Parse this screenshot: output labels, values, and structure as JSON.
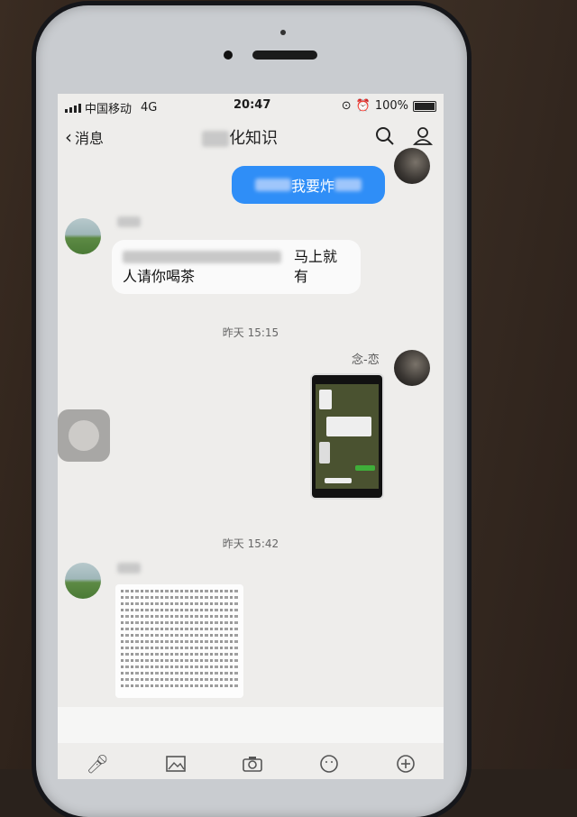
{
  "status": {
    "carrier": "中国移动",
    "network": "4G",
    "time": "20:47",
    "battery": "100%"
  },
  "nav": {
    "back_label": "消息",
    "title_visible": "化知识"
  },
  "messages": {
    "m1_text": "我要炸",
    "m2_text_line1": "马上就有",
    "m2_text_line2": "人请你喝茶",
    "ts1": "昨天 15:15",
    "m3_nick": "念-恋",
    "ts2": "昨天 15:42"
  },
  "colors": {
    "bubble_me": "#2f8ef7",
    "screen_bg": "#eeedeb"
  }
}
